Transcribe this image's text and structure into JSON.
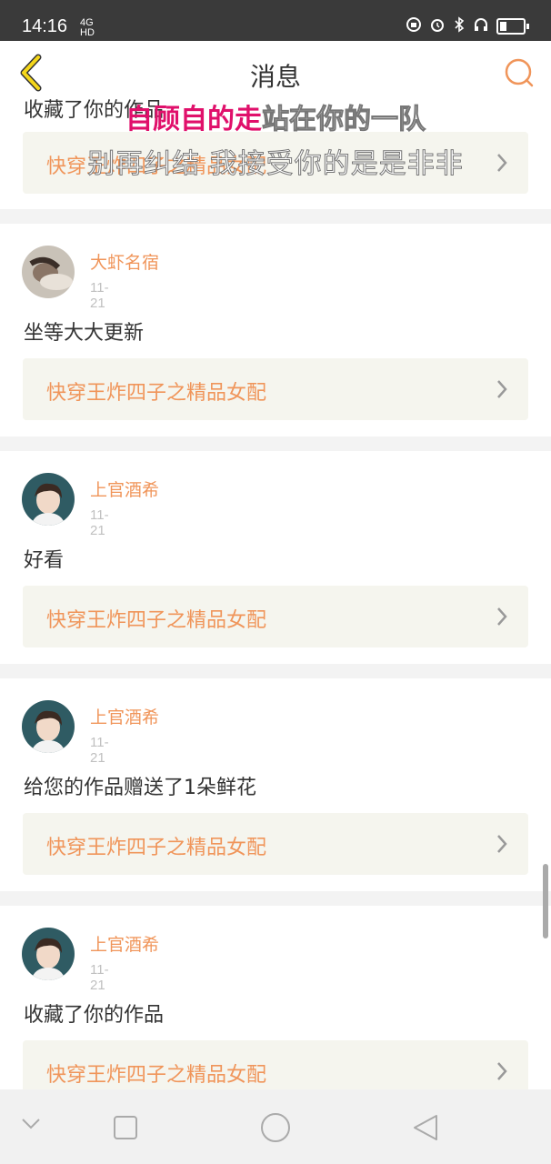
{
  "status": {
    "time": "14:16",
    "network_top": "4G",
    "network_bottom": "HD",
    "battery_level": 0.3
  },
  "header": {
    "title": "消息"
  },
  "lyrics": {
    "line1_highlight": "自顾自的走",
    "line1_rest": "站在你的一队",
    "line2": "别再纠结 我接受你的是是非非"
  },
  "top_card": {
    "message": "收藏了你的作品",
    "work_title": "快穿王炸四子之精品女配"
  },
  "cards": [
    {
      "username": "大虾名宿",
      "date": "11-21",
      "message": "坐等大大更新",
      "work_title": "快穿王炸四子之精品女配",
      "avatar": "photo-avatar"
    },
    {
      "username": "上官酒希",
      "date": "11-21",
      "message": "好看",
      "work_title": "快穿王炸四子之精品女配",
      "avatar": "anime-avatar"
    },
    {
      "username": "上官酒希",
      "date": "11-21",
      "message": "给您的作品赠送了1朵鲜花",
      "work_title": "快穿王炸四子之精品女配",
      "avatar": "anime-avatar"
    },
    {
      "username": "上官酒希",
      "date": "11-21",
      "message": "收藏了你的作品",
      "work_title": "快穿王炸四子之精品女配",
      "avatar": "anime-avatar"
    }
  ],
  "colors": {
    "accent": "#f0955a",
    "highlight_lyric": "#e0106b",
    "work_bg": "#f5f5ee"
  },
  "icons": {
    "back": "chevron-left-icon",
    "search": "search-icon",
    "item": "chevron-right-icon",
    "nav": [
      "chevron-down-icon",
      "square-icon",
      "circle-icon",
      "triangle-back-icon"
    ]
  }
}
